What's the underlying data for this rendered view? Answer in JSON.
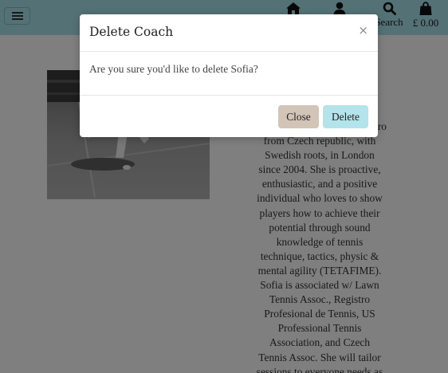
{
  "navbar": {
    "menu_icon": "hamburger-icon",
    "items": [
      {
        "icon": "home-icon",
        "label": ""
      },
      {
        "icon": "account-icon",
        "label": ""
      },
      {
        "icon": "search-icon",
        "label": "Search"
      },
      {
        "icon": "bag-icon",
        "label": "£ 0.00"
      }
    ]
  },
  "coach": {
    "bio_lines": [
      "from Czech republic, with",
      "Swedish roots, in London",
      "since 2004. She is proactive,",
      "enthusiastic, and a positive",
      "individual who loves to show",
      "players how to achieve their",
      "potential through sound",
      "knowledge of tennis",
      "technique, tactics, physic &",
      "mental agility (TETAFIME).",
      "Sofia is associated w/ Lawn",
      "Tennis Assoc., Registro",
      "Profesional de Tennis, US",
      "Professional Tennis",
      "Association, and Czech",
      "Tennis Assoc. She will tailor",
      "sessions to everyone needs as"
    ],
    "bio_partial_top": "ro"
  },
  "modal": {
    "title": "Delete Coach",
    "close_x": "×",
    "message": "Are you sure you'd like to delete Sofia?",
    "close_label": "Close",
    "delete_label": "Delete"
  },
  "colors": {
    "navbar": "#a9e4ec",
    "close_button": "#d3c4b8",
    "delete_button": "#b3e4ec",
    "backdrop": "rgba(0,0,0,0.5)"
  }
}
